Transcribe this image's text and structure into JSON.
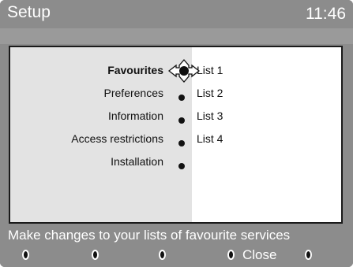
{
  "header": {
    "title": "Setup",
    "clock": "11:46"
  },
  "menu": {
    "items": [
      {
        "label": "Favourites",
        "selected": true
      },
      {
        "label": "Preferences",
        "selected": false
      },
      {
        "label": "Information",
        "selected": false
      },
      {
        "label": "Access restrictions",
        "selected": false
      },
      {
        "label": "Installation",
        "selected": false
      }
    ]
  },
  "submenu": {
    "items": [
      {
        "label": "List 1"
      },
      {
        "label": "List 2"
      },
      {
        "label": "List 3"
      },
      {
        "label": "List 4"
      }
    ]
  },
  "help": {
    "text": "Make changes to your lists of favourite services"
  },
  "keys": {
    "close_label": "Close",
    "icons": [
      "color-key-icon",
      "color-key-icon",
      "color-key-icon",
      "color-key-icon",
      "color-key-icon"
    ]
  },
  "colors": {
    "background": "#8c8c8c",
    "menu_panel": "#e3e3e3",
    "list_panel": "#ffffff",
    "text_light": "#ffffff",
    "text_dark": "#111111"
  }
}
